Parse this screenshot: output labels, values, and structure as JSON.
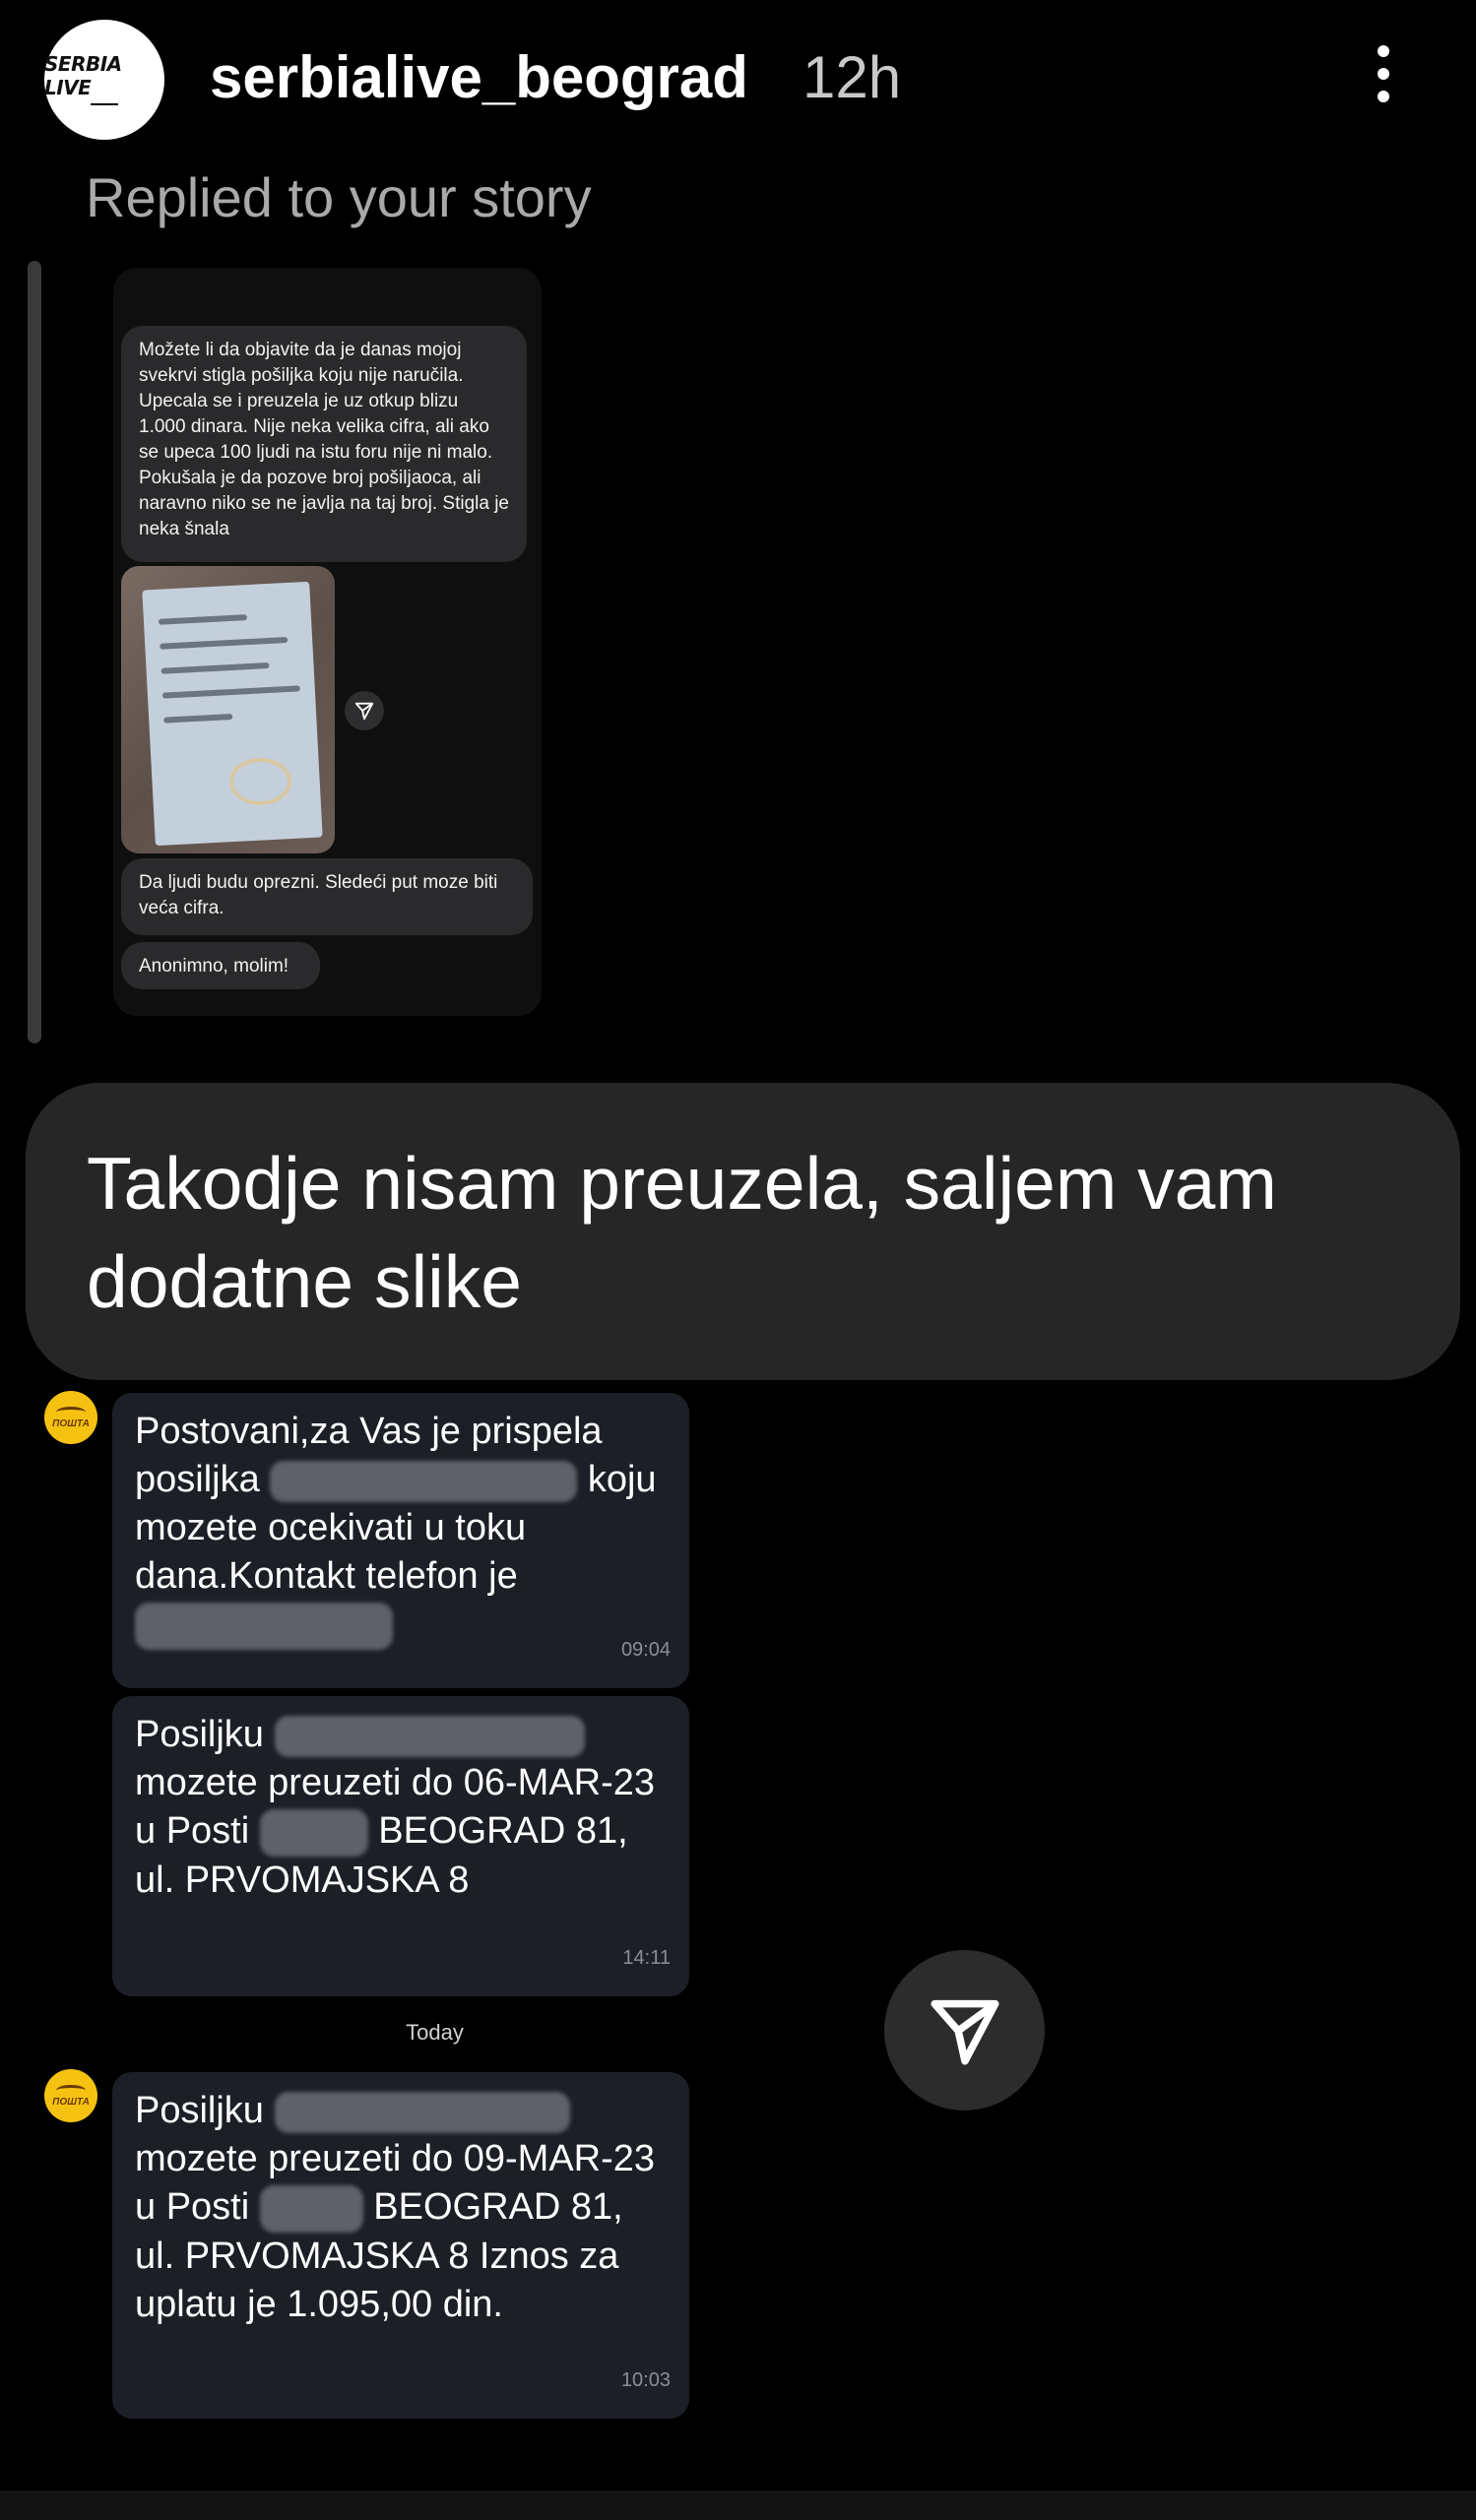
{
  "header": {
    "avatar_brand": "SERBIA LIVE",
    "username": "serbialive_beograd",
    "time": "12h",
    "replied_label": "Replied to your story"
  },
  "story": {
    "messages": [
      "Možete li da objavite da je danas mojoj svekrvi stigla pošiljka koju nije naručila. Upecala se i preuzela je uz otkup blizu 1.000 dinara. Nije neka velika cifra, ali ako se upeca 100 ljudi na istu foru nije ni malo. Pokušala je da pozove broj pošiljaoca,  ali naravno niko se ne javlja na taj broj. Stigla je neka šnala",
      "Da ljudi budu oprezni. Sledeći put moze biti veća cifra.",
      "Anonimno, molim!"
    ]
  },
  "reply": {
    "text": "Takodje nisam preuzela, saljem vam dodatne slike"
  },
  "sms": {
    "sender_logo": "ПОШТА",
    "msg1": {
      "part1": "Postovani,za Vas je prispela posiljka",
      "part2": "koju mozete ocekivati u toku dana.Kontakt telefon je",
      "time": "09:04"
    },
    "msg2": {
      "part1": "Posiljku",
      "part2": "mozete preuzeti do 06-MAR-23 u Posti",
      "part3": "BEOGRAD 81, ul. PRVOMAJSKA 8",
      "time": "14:11"
    },
    "day_separator": "Today",
    "msg3": {
      "part1": "Posiljku",
      "part2": "mozete preuzeti do 09-MAR-23 u Posti",
      "part3": "BEOGRAD 81, ul. PRVOMAJSKA 8 Iznos za uplatu je 1.095,00 din.",
      "time": "10:03"
    }
  }
}
